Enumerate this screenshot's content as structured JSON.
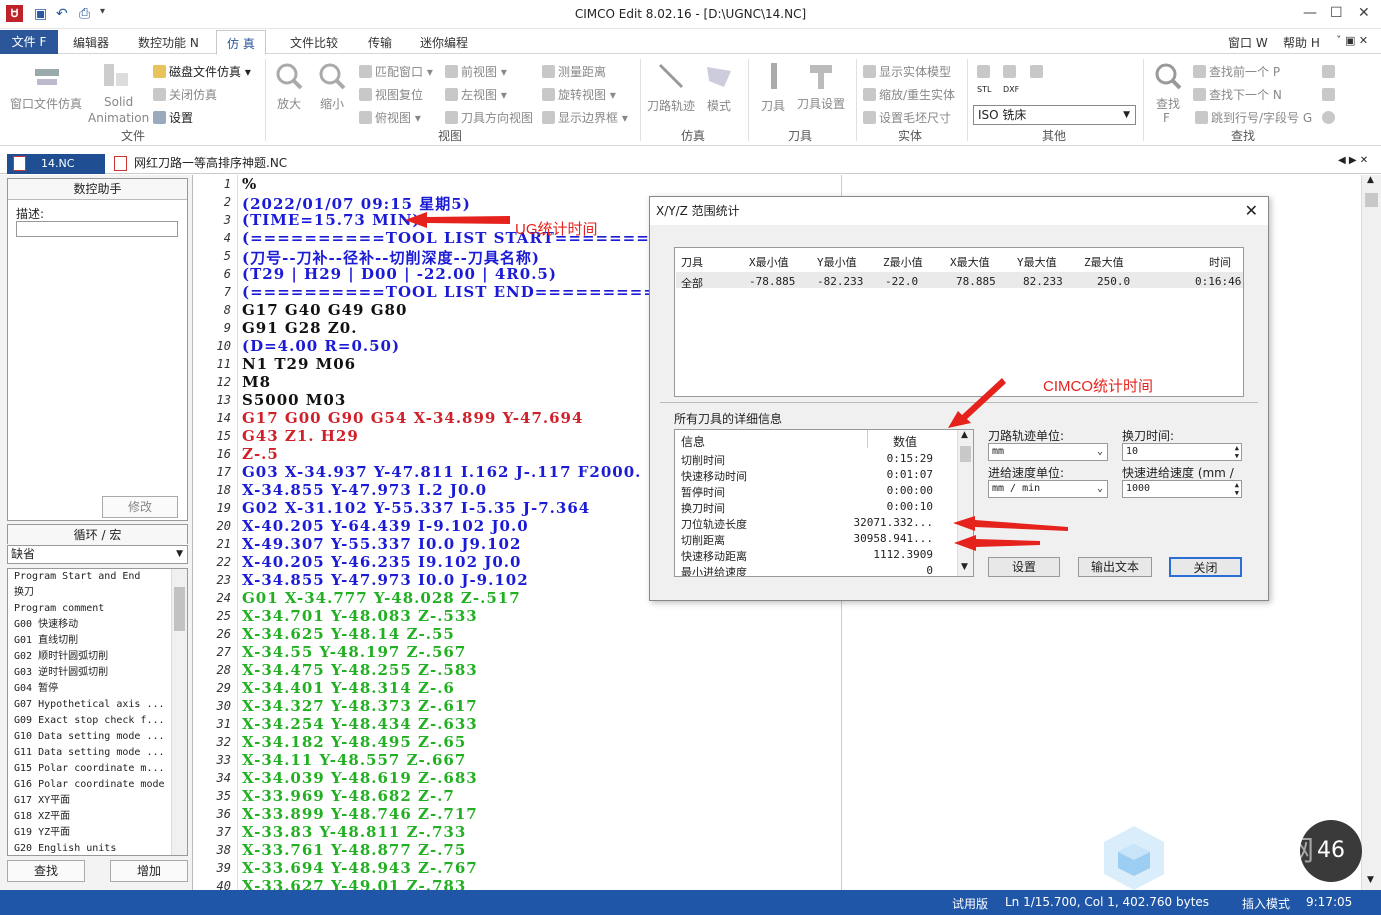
{
  "window": {
    "title": "CIMCO Edit 8.02.16 - [D:\\UGNC\\14.NC]",
    "logo": "Ꮜ"
  },
  "menu": {
    "file": "文件 F",
    "items": [
      "编辑器",
      "数控功能 N",
      "仿 真",
      "文件比较",
      "传输",
      "迷你编程"
    ],
    "right": [
      "窗口 W",
      "帮助 H"
    ]
  },
  "ribbon": {
    "file_group": {
      "window_sim": "窗口文件仿真",
      "solid": "Solid",
      "animation": "Animation",
      "disk_sim": "磁盘文件仿真",
      "close_sim": "关闭仿真",
      "settings": "设置",
      "group_label": "文件"
    },
    "view_group": {
      "zoom_in": "放大",
      "zoom_out": "缩小",
      "match_window": "匹配窗口",
      "reset_view": "视图复位",
      "top_view": "俯视图",
      "front_view": "前视图",
      "left_view": "左视图",
      "tool_dir_view": "刀具方向视图",
      "measure": "测量距离",
      "rotate_view": "旋转视图",
      "show_bounds": "显示边界框",
      "group_label": "视图"
    },
    "sim_group": {
      "toolpath": "刀路轨迹",
      "mode": "模式",
      "group_label": "仿真"
    },
    "tool_group": {
      "tool": "刀具",
      "tool_settings": "刀具设置",
      "group_label": "刀具"
    },
    "solid_group": {
      "show_solid": "显示实体模型",
      "scale_solid": "缩放/重生实体",
      "stock_size": "设置毛坯尺寸",
      "group_label": "实体"
    },
    "other_group": {
      "stl": "STL",
      "dxf": "DXF",
      "machine_select": "ISO 铣床",
      "group_label": "其他"
    },
    "find_group": {
      "find": "查找",
      "find_key": "F",
      "find_prev": "查找前一个 P",
      "find_next": "查找下一个 N",
      "goto_line": "跳到行号/字段号 G",
      "group_label": "查找"
    }
  },
  "tabs": [
    {
      "label": "14.NC",
      "active": true
    },
    {
      "label": "网红刀路一等高排序神题.NC",
      "active": false
    }
  ],
  "left_panel": {
    "assistant_title": "数控助手",
    "desc_label": "描述:",
    "modify_button": "修改",
    "macro_title": "循环 / 宏",
    "macro_select": "缺省",
    "macros": [
      "Program Start and End",
      "换刀",
      "Program comment",
      "G00 快速移动",
      "G01 直线切削",
      "G02 顺时针圆弧切削",
      "G03 逆时针圆弧切削",
      "G04 暂停",
      "G07 Hypothetical axis ...",
      "G09 Exact stop check f...",
      "G10 Data setting mode ...",
      "G11 Data setting mode ...",
      "G15 Polar coordinate m...",
      "G16 Polar coordinate mode",
      "G17 XY平面",
      "G18 XZ平面",
      "G19 YZ平面",
      "G20 English units"
    ],
    "find_button": "查找",
    "add_button": "增加"
  },
  "code_lines": [
    {
      "n": "1",
      "t": "%",
      "c": "black"
    },
    {
      "n": "2",
      "t": "(2022/01/07 09:15 星期5)",
      "c": "blue"
    },
    {
      "n": "3",
      "t": "(TIME=15.73 MIN)",
      "c": "blue"
    },
    {
      "n": "4",
      "t": "(==========TOOL LIST START==========)",
      "c": "blue"
    },
    {
      "n": "5",
      "t": "(刀号--刀补--径补--切削深度--刀具名称)",
      "c": "blue"
    },
    {
      "n": "6",
      "t": "(T29 | H29 | D00 | -22.00 | 4R0.5)",
      "c": "blue"
    },
    {
      "n": "7",
      "t": "(==========TOOL LIST END===========)",
      "c": "blue"
    },
    {
      "n": "8",
      "t": "G17 G40 G49 G80",
      "c": "black"
    },
    {
      "n": "9",
      "t": "G91 G28 Z0.",
      "c": "black"
    },
    {
      "n": "10",
      "t": "(D=4.00 R=0.50)",
      "c": "blue"
    },
    {
      "n": "11",
      "t": "N1 T29 M06",
      "c": "black"
    },
    {
      "n": "12",
      "t": "M8",
      "c": "black"
    },
    {
      "n": "13",
      "t": "S5000 M03",
      "c": "black"
    },
    {
      "n": "14",
      "t": "G17 G00 G90 G54 X-34.899 Y-47.694",
      "c": "red"
    },
    {
      "n": "15",
      "t": "G43 Z1. H29",
      "c": "red"
    },
    {
      "n": "16",
      "t": "Z-.5",
      "c": "red"
    },
    {
      "n": "17",
      "t": "G03 X-34.937 Y-47.811 I.162 J-.117 F2000.",
      "c": "blue"
    },
    {
      "n": "18",
      "t": "X-34.855 Y-47.973 I.2 J0.0",
      "c": "blue"
    },
    {
      "n": "19",
      "t": "G02 X-31.102 Y-55.337 I-5.35 J-7.364",
      "c": "blue"
    },
    {
      "n": "20",
      "t": "X-40.205 Y-64.439 I-9.102 J0.0",
      "c": "blue"
    },
    {
      "n": "21",
      "t": "X-49.307 Y-55.337 I0.0 J9.102",
      "c": "blue"
    },
    {
      "n": "22",
      "t": "X-40.205 Y-46.235 I9.102 J0.0",
      "c": "blue"
    },
    {
      "n": "23",
      "t": "X-34.855 Y-47.973 I0.0 J-9.102",
      "c": "blue"
    },
    {
      "n": "24",
      "t": "G01 X-34.777 Y-48.028 Z-.517",
      "c": "green"
    },
    {
      "n": "25",
      "t": "X-34.701 Y-48.083 Z-.533",
      "c": "green"
    },
    {
      "n": "26",
      "t": "X-34.625 Y-48.14 Z-.55",
      "c": "green"
    },
    {
      "n": "27",
      "t": "X-34.55 Y-48.197 Z-.567",
      "c": "green"
    },
    {
      "n": "28",
      "t": "X-34.475 Y-48.255 Z-.583",
      "c": "green"
    },
    {
      "n": "29",
      "t": "X-34.401 Y-48.314 Z-.6",
      "c": "green"
    },
    {
      "n": "30",
      "t": "X-34.327 Y-48.373 Z-.617",
      "c": "green"
    },
    {
      "n": "31",
      "t": "X-34.254 Y-48.434 Z-.633",
      "c": "green"
    },
    {
      "n": "32",
      "t": "X-34.182 Y-48.495 Z-.65",
      "c": "green"
    },
    {
      "n": "33",
      "t": "X-34.11 Y-48.557 Z-.667",
      "c": "green"
    },
    {
      "n": "34",
      "t": "X-34.039 Y-48.619 Z-.683",
      "c": "green"
    },
    {
      "n": "35",
      "t": "X-33.969 Y-48.682 Z-.7",
      "c": "green"
    },
    {
      "n": "36",
      "t": "X-33.899 Y-48.746 Z-.717",
      "c": "green"
    },
    {
      "n": "37",
      "t": "X-33.83 Y-48.811 Z-.733",
      "c": "green"
    },
    {
      "n": "38",
      "t": "X-33.761 Y-48.877 Z-.75",
      "c": "green"
    },
    {
      "n": "39",
      "t": "X-33.694 Y-48.943 Z-.767",
      "c": "green"
    },
    {
      "n": "40",
      "t": "X-33.627 Y-49.01 Z-.783",
      "c": "green"
    }
  ],
  "dialog": {
    "title": "X/Y/Z 范围统计",
    "columns": [
      "刀具",
      "X最小值",
      "Y最小值",
      "Z最小值",
      "X最大值",
      "Y最大值",
      "Z最大值",
      "时间"
    ],
    "row": [
      "全部",
      "-78.885",
      "-82.233",
      "-22.0",
      "78.885",
      "82.233",
      "250.0",
      "0:16:46"
    ],
    "detail_title": "所有刀具的详细信息",
    "detail_headers": [
      "信息",
      "数值"
    ],
    "details": [
      {
        "k": "切削时间",
        "v": "0:15:29"
      },
      {
        "k": "快速移动时间",
        "v": "0:01:07"
      },
      {
        "k": "暂停时间",
        "v": "0:00:00"
      },
      {
        "k": "换刀时间",
        "v": "0:00:10"
      },
      {
        "k": "刀位轨迹长度",
        "v": "32071.332..."
      },
      {
        "k": "切削距离",
        "v": "30958.941..."
      },
      {
        "k": "快速移动距离",
        "v": "1112.3909"
      },
      {
        "k": "最小进给速度",
        "v": "0"
      }
    ],
    "toolpath_unit_label": "刀路轨迹单位:",
    "toolpath_unit": "mm",
    "feed_unit_label": "进给速度单位:",
    "feed_unit": "mm / min",
    "tool_change_label": "换刀时间:",
    "tool_change": "10",
    "rapid_feed_label": "快速进给速度 (mm /",
    "rapid_feed": "1000",
    "settings_button": "设置",
    "export_button": "输出文本",
    "close_button": "关闭"
  },
  "annotations": {
    "ug": "UG统计时间",
    "cimco": "CIMCO统计时间"
  },
  "status": {
    "trial": "试用版",
    "position": "Ln 1/15.700, Col 1, 402.760 bytes",
    "mode": "插入模式",
    "time": "9:17:05"
  },
  "overlay": {
    "gauge": "46",
    "watermark_text": "网"
  },
  "colors": {
    "accent": "#2b579a",
    "status_bar": "#1f56a8",
    "code_blue": "#1b1bd6",
    "code_red": "#d0202a",
    "code_green": "#22b022",
    "annotation": "#e5221c"
  }
}
